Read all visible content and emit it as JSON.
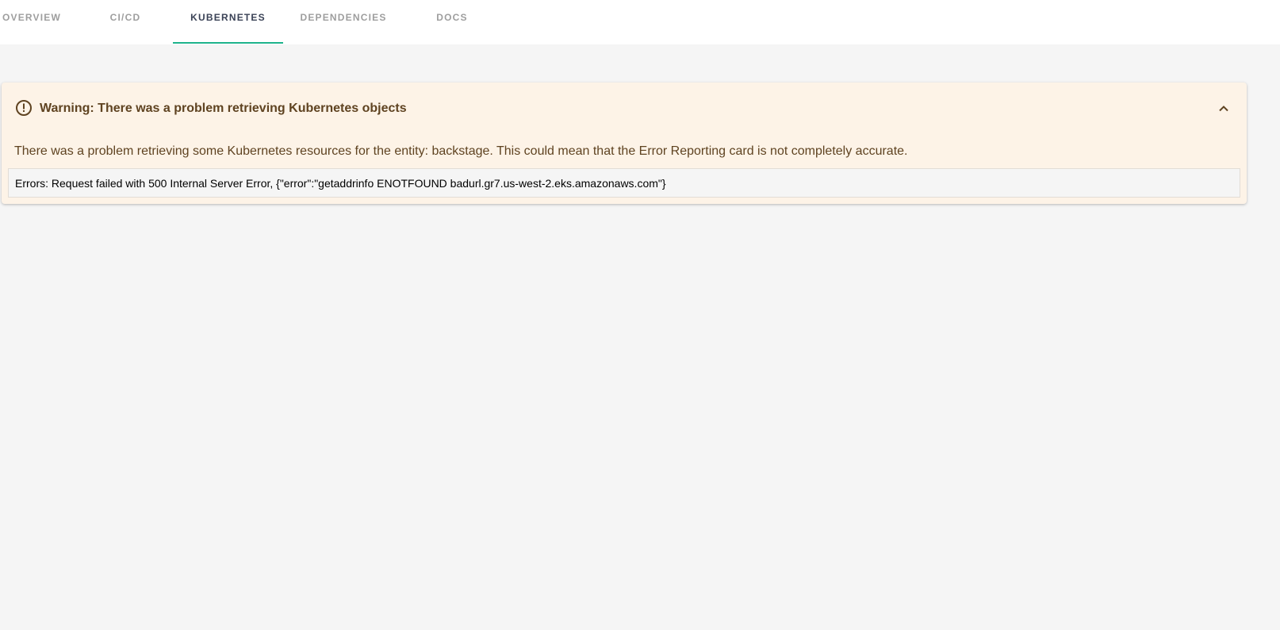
{
  "tabs": [
    {
      "label": "OVERVIEW",
      "active": false
    },
    {
      "label": "CI/CD",
      "active": false
    },
    {
      "label": "KUBERNETES",
      "active": true
    },
    {
      "label": "DEPENDENCIES",
      "active": false
    },
    {
      "label": "DOCS",
      "active": false
    }
  ],
  "colors": {
    "accent": "#1db38b",
    "warning_bg": "#fdf3e7",
    "warning_text": "#5f4321"
  },
  "warning": {
    "icon": "error-outline-icon",
    "title": "Warning: There was a problem retrieving Kubernetes objects",
    "collapse_icon": "chevron-up-icon",
    "message": "There was a problem retrieving some Kubernetes resources for the entity: backstage. This could mean that the Error Reporting card is not completely accurate.",
    "errors": "Errors: Request failed with 500 Internal Server Error, {\"error\":\"getaddrinfo ENOTFOUND badurl.gr7.us-west-2.eks.amazonaws.com\"}"
  }
}
